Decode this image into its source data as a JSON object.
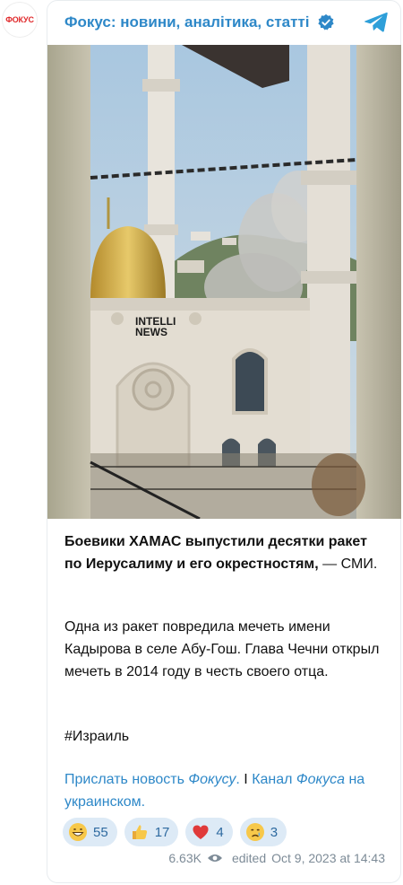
{
  "channel": {
    "avatar_text": "ФОКУС",
    "title": "Фокус: новини, аналітика, статті"
  },
  "photo": {
    "watermark_line1": "INTELLI",
    "watermark_line2": "NEWS"
  },
  "post": {
    "headline_bold": "Боевики ХАМАС выпустили десятки ракет по Иерусалиму и его окрестностям,",
    "headline_rest": " — СМИ.",
    "body": "Одна из ракет повредила мечеть имени Кадырова в селе Абу-Гош. Глава Чечни открыл мечеть в 2014 году в честь своего отца.",
    "hashtag": "#Израиль",
    "link1_part1": "Прислать новость ",
    "link1_italic": "Фокусу",
    "link1_part2": ".",
    "separator": " I ",
    "link2_part1": "Канал ",
    "link2_italic": "Фокуса",
    "link2_part2": " на украинском."
  },
  "reactions": [
    {
      "icon": "grin-emoji",
      "count": "55"
    },
    {
      "icon": "thumbs-up-emoji",
      "count": "17"
    },
    {
      "icon": "heart-emoji",
      "count": "4"
    },
    {
      "icon": "crying-emoji",
      "count": "3"
    }
  ],
  "meta": {
    "views": "6.63K",
    "edited_label": "edited",
    "timestamp": "Oct 9, 2023 at 14:43"
  },
  "colors": {
    "link": "#2e88c8",
    "reaction_bg": "#ddeaf6",
    "avatar_text": "#e0292b"
  }
}
